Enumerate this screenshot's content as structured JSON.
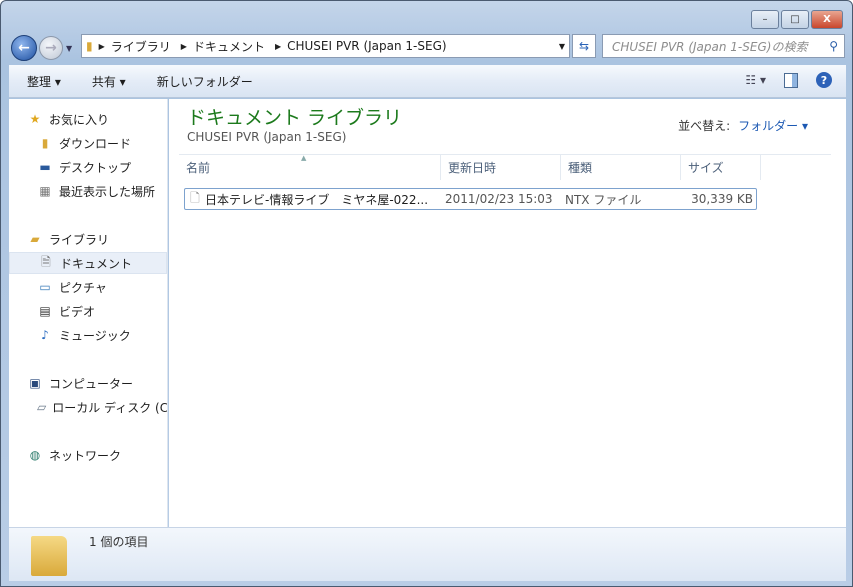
{
  "window": {
    "minimize": "–",
    "maximize": "□",
    "close": "X"
  },
  "address": {
    "segments": [
      "ライブラリ",
      "ドキュメント",
      "CHUSEI PVR (Japan 1-SEG)"
    ]
  },
  "search": {
    "placeholder": "CHUSEI PVR (Japan 1-SEG)の検索"
  },
  "toolbar": {
    "organize": "整理 ▾",
    "share": "共有 ▾",
    "new_folder": "新しいフォルダー",
    "help": "?"
  },
  "sidebar": {
    "favorites": {
      "label": "お気に入り",
      "items": [
        "ダウンロード",
        "デスクトップ",
        "最近表示した場所"
      ]
    },
    "libraries": {
      "label": "ライブラリ",
      "items": [
        "ドキュメント",
        "ピクチャ",
        "ビデオ",
        "ミュージック"
      ]
    },
    "computer": {
      "label": "コンピューター",
      "items": [
        "ローカル ディスク (C:)"
      ]
    },
    "network": {
      "label": "ネットワーク"
    }
  },
  "main": {
    "title": "ドキュメント ライブラリ",
    "subtitle": "CHUSEI PVR (Japan 1-SEG)",
    "sort_label": "並べ替え:",
    "sort_value": "フォルダー ▾",
    "columns": [
      "名前",
      "更新日時",
      "種類",
      "サイズ"
    ],
    "files": [
      {
        "name": "日本テレビ-情報ライブ　ミヤネ屋-022...",
        "modified": "2011/02/23 15:03",
        "type": "NTX ファイル",
        "size": "30,339 KB"
      }
    ]
  },
  "status": {
    "count": "1 個の項目"
  }
}
